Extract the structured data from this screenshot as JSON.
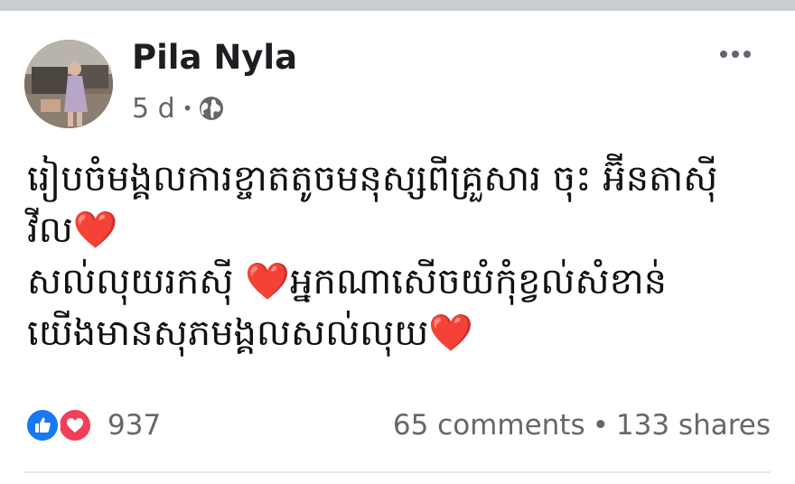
{
  "post": {
    "author": "Pila Nyla",
    "time": "5 d",
    "privacy_icon": "globe-icon",
    "text_lines": [
      "រៀបចំមង្គលការខ្ចាតតូចមនុស្សពីគ្រួសារ ចុះ អ៊ីនតាស៊ី",
      "វីល",
      "សល់លុយរកស៊ី",
      "អ្នកណាសើចយំកុំខ្វល់សំខាន់",
      "យើងមានសុភមង្គលសល់លុយ"
    ],
    "heart_glyph": "❤️"
  },
  "reactions": {
    "count": "937",
    "icons": [
      "like-icon",
      "love-icon"
    ]
  },
  "stats": {
    "comments": "65 comments",
    "separator": "•",
    "shares": "133 shares"
  },
  "colors": {
    "author": "#1c1e21",
    "meta": "#65676b",
    "like_blue": "#1877f2",
    "love_red": "#f33e58",
    "heart": "#f02849"
  }
}
